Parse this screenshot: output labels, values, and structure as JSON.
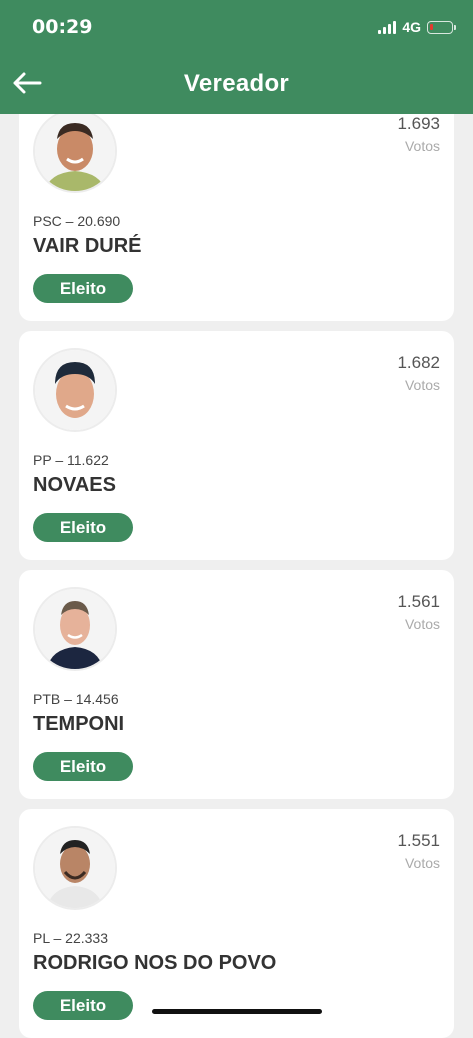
{
  "status_bar": {
    "time": "00:29",
    "network": "4G"
  },
  "header": {
    "title": "Vereador"
  },
  "candidates": [
    {
      "party_number": "PSC – 20.690",
      "name": "VAIR DURÉ",
      "votes": "1.693",
      "votes_label": "Votos",
      "status": "Eleito"
    },
    {
      "party_number": "PP – 11.622",
      "name": "NOVAES",
      "votes": "1.682",
      "votes_label": "Votos",
      "status": "Eleito"
    },
    {
      "party_number": "PTB – 14.456",
      "name": "TEMPONI",
      "votes": "1.561",
      "votes_label": "Votos",
      "status": "Eleito"
    },
    {
      "party_number": "PL – 22.333",
      "name": "RODRIGO NOS DO POVO",
      "votes": "1.551",
      "votes_label": "Votos",
      "status": "Eleito"
    }
  ],
  "colors": {
    "brand": "#3f8b5f",
    "background": "#efefef",
    "battery_low": "#e23b2e"
  }
}
